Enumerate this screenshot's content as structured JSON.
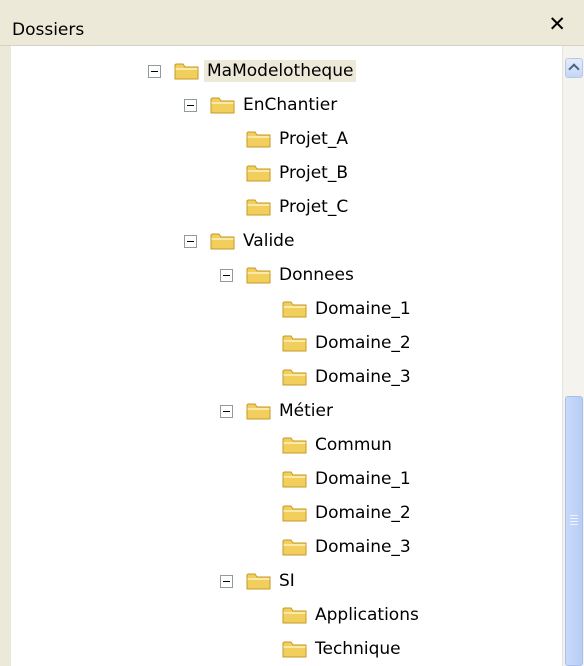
{
  "panel": {
    "title": "Dossiers",
    "close_label": "✕"
  },
  "tree": {
    "nodes": [
      {
        "label": "MaModelotheque",
        "depth": 0,
        "expanded": true,
        "selected": true
      },
      {
        "label": "EnChantier",
        "depth": 1,
        "expanded": true
      },
      {
        "label": "Projet_A",
        "depth": 2
      },
      {
        "label": "Projet_B",
        "depth": 2
      },
      {
        "label": "Projet_C",
        "depth": 2
      },
      {
        "label": "Valide",
        "depth": 1,
        "expanded": true
      },
      {
        "label": "Donnees",
        "depth": 2,
        "expanded": true
      },
      {
        "label": "Domaine_1",
        "depth": 3
      },
      {
        "label": "Domaine_2",
        "depth": 3
      },
      {
        "label": "Domaine_3",
        "depth": 3
      },
      {
        "label": "Métier",
        "depth": 2,
        "expanded": true
      },
      {
        "label": "Commun",
        "depth": 3
      },
      {
        "label": "Domaine_1",
        "depth": 3
      },
      {
        "label": "Domaine_2",
        "depth": 3
      },
      {
        "label": "Domaine_3",
        "depth": 3
      },
      {
        "label": "SI",
        "depth": 2,
        "expanded": true
      },
      {
        "label": "Applications",
        "depth": 3
      },
      {
        "label": "Technique",
        "depth": 3
      }
    ]
  },
  "colors": {
    "folder_body": "#f2ce5e",
    "folder_edge": "#c49a24",
    "folder_light": "#fbe9a8"
  }
}
